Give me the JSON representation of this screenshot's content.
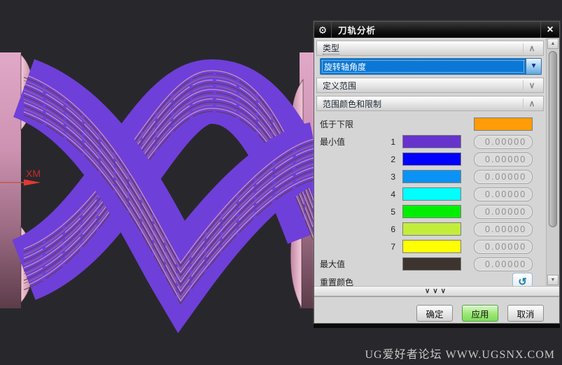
{
  "viewport": {
    "axis_label": "XM",
    "background": "#28282c",
    "toolpath_color": "#6f3fd9",
    "part_color_top": "#e2a8c8",
    "part_color_bottom": "#5c3c49"
  },
  "dialog": {
    "title": "刀轨分析",
    "icons": {
      "gear": "⚙",
      "close": "×",
      "collapse": "∧",
      "expand": "∨",
      "combo_arrow": "▼",
      "scroll_up": "▲",
      "scroll_down": "▼",
      "reset": "↺",
      "resize": "∨∨∨"
    },
    "sections": {
      "type": "类型",
      "define_range": "定义范围",
      "range_colors": "范围颜色和限制"
    },
    "combo": {
      "value": "旋转轴角度"
    },
    "range": {
      "below_lower_label": "低于下限",
      "below_lower_color": "#ff9c08",
      "min_label": "最小值",
      "max_label": "最大值",
      "max_color": "#3e342f",
      "max_value": "0.00000",
      "reset_label": "重置颜色",
      "levels": [
        {
          "num": "1",
          "color": "#6633cc",
          "value": "0.00000"
        },
        {
          "num": "2",
          "color": "#0000ff",
          "value": "0.00000"
        },
        {
          "num": "3",
          "color": "#0a93f5",
          "value": "0.00000"
        },
        {
          "num": "4",
          "color": "#00ffff",
          "value": "0.00000"
        },
        {
          "num": "5",
          "color": "#00ee00",
          "value": "0.00000"
        },
        {
          "num": "6",
          "color": "#c3ed3d",
          "value": "0.00000"
        },
        {
          "num": "7",
          "color": "#ffff00",
          "value": "0.00000"
        }
      ]
    },
    "buttons": {
      "ok": "确定",
      "apply": "应用",
      "cancel": "取消"
    }
  },
  "watermark": "UG爱好者论坛 WWW.UGSNX.COM"
}
